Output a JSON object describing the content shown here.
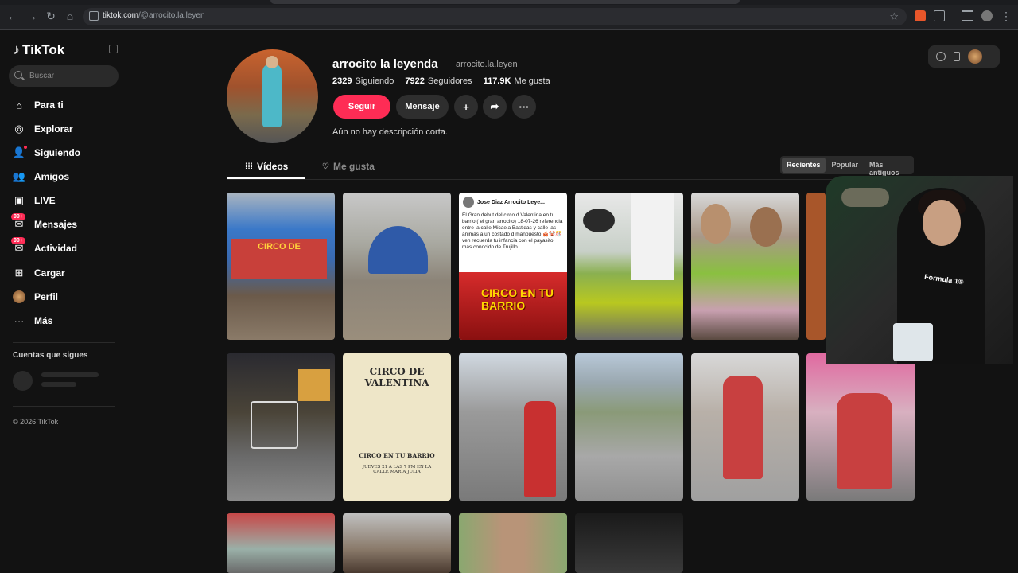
{
  "browser": {
    "url_host": "tiktok.com",
    "url_path": "/@arrocito.la.leyen"
  },
  "sidebar": {
    "brand": "TikTok",
    "search_placeholder": "Buscar",
    "items": [
      {
        "label": "Para ti",
        "icon": "home-icon"
      },
      {
        "label": "Explorar",
        "icon": "compass-icon"
      },
      {
        "label": "Siguiendo",
        "icon": "following-icon"
      },
      {
        "label": "Amigos",
        "icon": "friends-icon"
      },
      {
        "label": "LIVE",
        "icon": "live-icon"
      },
      {
        "label": "Mensajes",
        "icon": "messages-icon",
        "badge": "99+"
      },
      {
        "label": "Actividad",
        "icon": "activity-icon",
        "badge": "99+"
      },
      {
        "label": "Cargar",
        "icon": "upload-icon"
      },
      {
        "label": "Perfil",
        "icon": "profile-icon"
      },
      {
        "label": "Más",
        "icon": "more-icon"
      }
    ],
    "following_title": "Cuentas que sigues",
    "copyright": "© 2026 TikTok"
  },
  "profile": {
    "username": "arrocito la leyenda",
    "handle": "arrocito.la.leyen",
    "following_count": "2329",
    "following_label": "Siguiendo",
    "followers_count": "7922",
    "followers_label": "Seguidores",
    "likes_count": "117.9K",
    "likes_label": "Me gusta",
    "follow_button": "Seguir",
    "message_button": "Mensaje",
    "bio": "Aún no hay descripción corta."
  },
  "tabs": {
    "videos": "Vídeos",
    "liked": "Me gusta"
  },
  "sort": {
    "options": [
      "Recientes",
      "Popular",
      "Más antiguos"
    ],
    "selected": "Recientes"
  },
  "posts": {
    "card_author": "Jose Diaz Arrocito Leye...",
    "card_text": "El Gran debut del circo d Valentina en tu barrio ( el gran arrocito) 18-07-26 referencia entre la calle Micaela Bastidas y calle las animas a un costado d manpuesto 🎪🤡🎊 ven recuerda tu infancia con el payasito más conocido de Trujillo",
    "card_image_title": "CIRCO EN TU BARRIO",
    "tent_banner_text": "CIRCO DE",
    "poster_title": "CIRCO DE VALENTINA",
    "poster_subtitle": "CIRCO EN TU BARRIO",
    "poster_detail": "JUEVES 21 A LAS 7 PM EN LA CALLE MARÍA JULIA"
  },
  "webcam": {
    "shirt_text": "Formula 1®"
  }
}
